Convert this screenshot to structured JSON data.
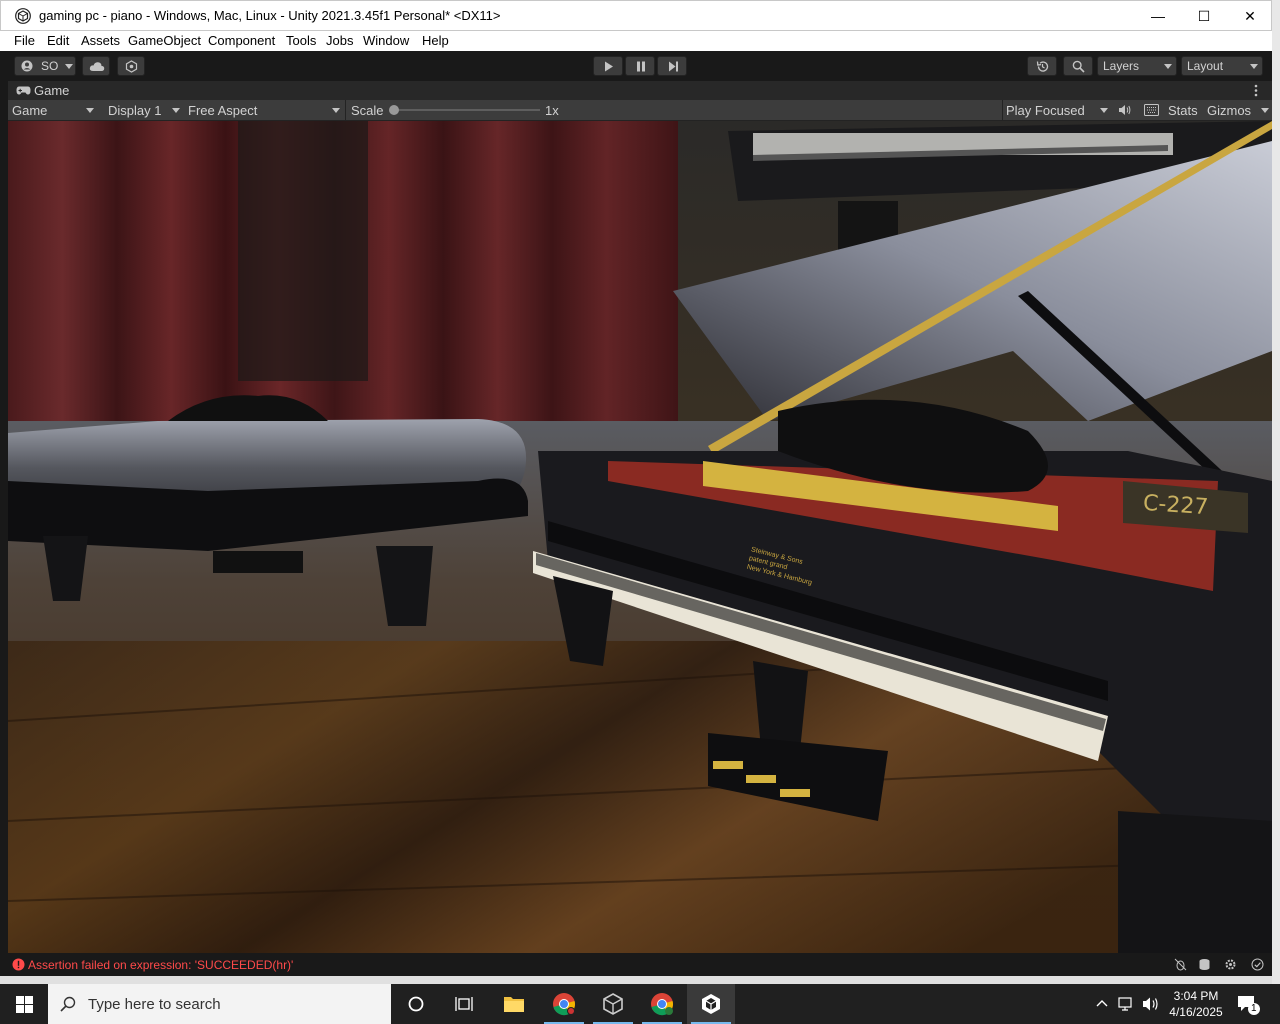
{
  "window": {
    "title": "gaming pc - piano - Windows, Mac, Linux - Unity 2021.3.45f1 Personal* <DX11>",
    "minimize": "—",
    "maximize": "☐",
    "close": "✕"
  },
  "menu": [
    "File",
    "Edit",
    "Assets",
    "GameObject",
    "Component",
    "Tools",
    "Jobs",
    "Window",
    "Help"
  ],
  "toolbar": {
    "account_label": "SO",
    "layers_label": "Layers",
    "layout_label": "Layout"
  },
  "tab": {
    "label": "Game"
  },
  "game_toolbar": {
    "view_mode": "Game",
    "display": "Display 1",
    "aspect": "Free Aspect",
    "scale_label": "Scale",
    "scale_value": "1x",
    "scale_level": 0,
    "play_mode": "Play Focused",
    "stats_label": "Stats",
    "gizmos_label": "Gizmos"
  },
  "scene": {
    "label_plate": "C-227",
    "fallboard_text": [
      "Steinway & Sons",
      "patent grand",
      "New York & Hamburg"
    ]
  },
  "status": {
    "error_message": "Assertion failed on expression: 'SUCCEEDED(hr)'"
  },
  "taskbar": {
    "search_placeholder": "Type here to search",
    "time": "3:04 PM",
    "date": "4/16/2025",
    "notification_count": "1"
  },
  "colors": {
    "error_red": "#ff4a4a",
    "accent_blue": "#76b9ed",
    "toolbar_dark": "#191919"
  }
}
